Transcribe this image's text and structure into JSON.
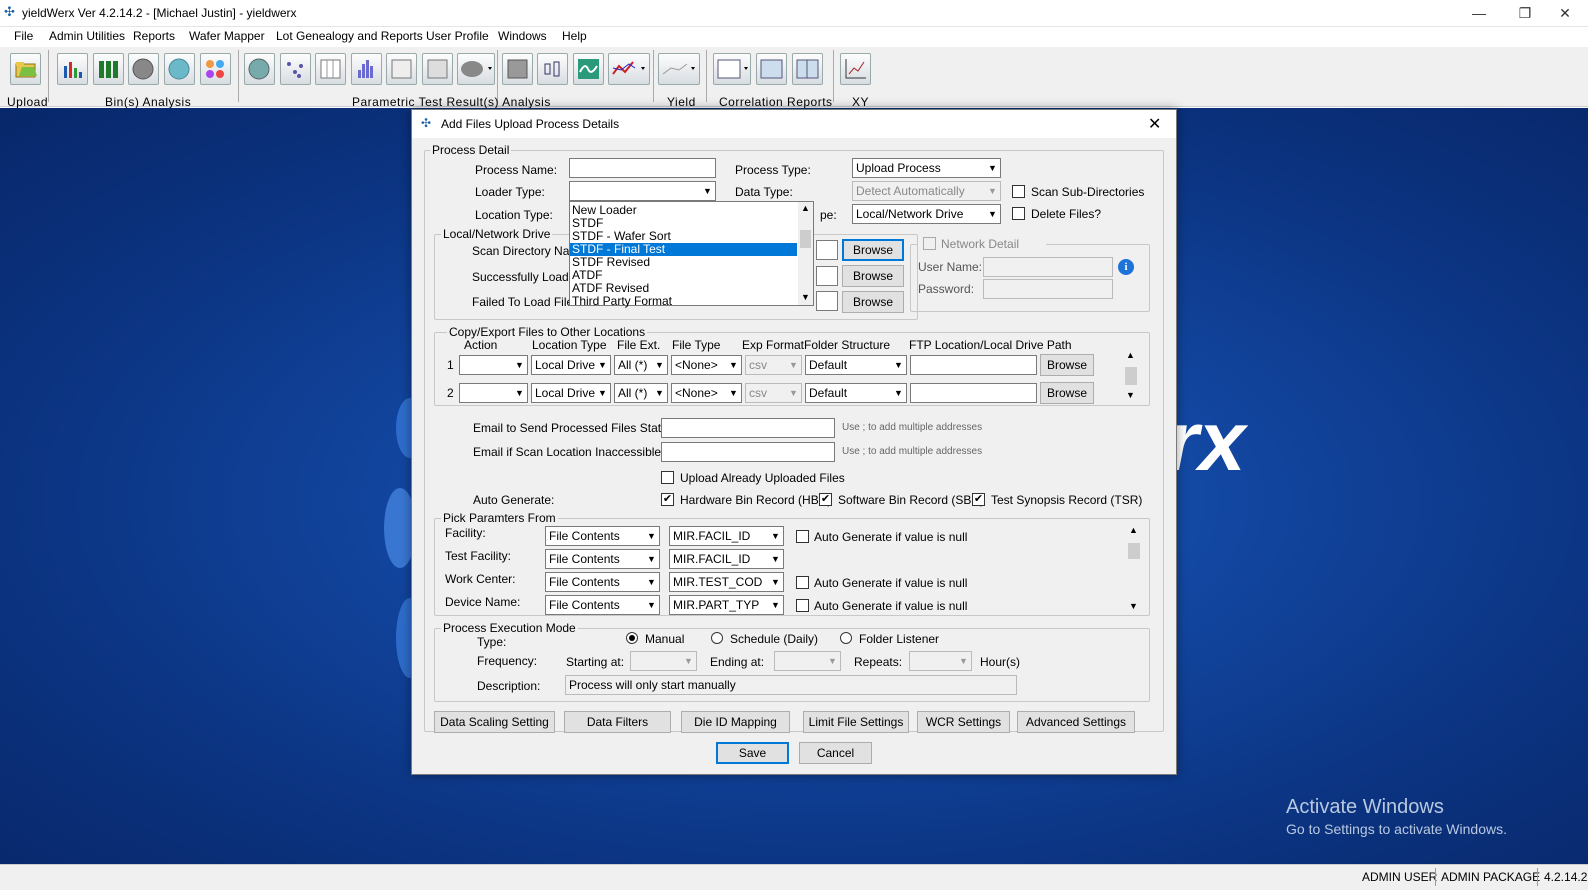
{
  "app": {
    "title": "yieldWerx Ver 4.2.14.2 - [Michael Justin] - yieldwerx",
    "window_controls": {
      "minimize": "—",
      "restore": "❐",
      "close": "✕"
    }
  },
  "menu": [
    "File",
    "Admin Utilities",
    "Reports",
    "Wafer Mapper",
    "Lot Genealogy and Reports",
    "User Profile",
    "Windows",
    "Help"
  ],
  "toolbar": {
    "groups": [
      "Upload",
      "Bin(s) Analysis",
      "Parametric Test Result(s) Analysis",
      "Yield",
      "Correlation Reports",
      "XY"
    ]
  },
  "desktop": {
    "logo_fragment": "rx",
    "watermark_title": "Activate Windows",
    "watermark_sub": "Go to Settings to activate Windows."
  },
  "statusbar": {
    "user": "ADMIN USER",
    "package": "ADMIN PACKAGE",
    "version": "4.2.14.2"
  },
  "dialog": {
    "title": "Add Files Upload Process Details",
    "process_detail": {
      "group_label": "Process Detail",
      "process_name_label": "Process Name:",
      "process_name_value": "",
      "loader_type_label": "Loader Type:",
      "loader_type_value": "",
      "location_type_label": "Location Type:",
      "process_type_label": "Process Type:",
      "process_type_value": "Upload Process",
      "data_type_label": "Data  Type:",
      "data_type_value": "Detect Automatically",
      "location_type2_label": "pe:",
      "location_type2_value": "Local/Network Drive",
      "scan_sub_label": "Scan Sub-Directories",
      "delete_files_label": "Delete Files?"
    },
    "loader_dropdown": {
      "options": [
        "New Loader",
        "STDF",
        "STDF - Wafer Sort",
        "STDF - Final Test",
        "STDF Revised",
        "ATDF",
        "ATDF Revised",
        "Third Party Format"
      ],
      "selected": "STDF - Final Test"
    },
    "local_network": {
      "group_label": "Local/Network Drive",
      "scan_dir_label": "Scan Directory Nar",
      "success_label": "Successfully Loade",
      "failed_label": "Failed To Load File",
      "browse": "Browse"
    },
    "network_detail": {
      "label": "Network Detail",
      "user_label": "User Name:",
      "password_label": "Password:",
      "info_icon": "i"
    },
    "copy_export": {
      "group_label": "Copy/Export Files to Other Locations",
      "headers": [
        "Action",
        "Location Type",
        "File Ext.",
        "File Type",
        "Exp Format",
        "Folder Structure",
        "FTP Location/Local Drive Path"
      ],
      "rows": [
        {
          "num": "1",
          "action": "",
          "location": "Local Drive",
          "ext": "All (*)",
          "type": "<None>",
          "format": "csv",
          "folder": "Default",
          "path": "",
          "browse": "Browse"
        },
        {
          "num": "2",
          "action": "",
          "location": "Local Drive",
          "ext": "All (*)",
          "type": "<None>",
          "format": "csv",
          "folder": "Default",
          "path": "",
          "browse": "Browse"
        }
      ]
    },
    "email": {
      "processed_label": "Email to Send Processed Files Status:",
      "inaccessible_label": "Email if Scan Location Inaccessible:",
      "hint": "Use ; to add multiple addresses"
    },
    "upload_already_label": "Upload Already Uploaded Files",
    "auto_generate": {
      "label": "Auto Generate:",
      "hbr": "Hardware Bin Record (HBR)",
      "sbr": "Software Bin Record (SBR)",
      "tsr": "Test Synopsis Record (TSR)"
    },
    "pick_params": {
      "group_label": "Pick Paramters From",
      "rows": [
        {
          "label": "Facility:",
          "source": "File Contents",
          "field": "MIR.FACIL_ID",
          "auto": "Auto Generate if value is null",
          "has_auto": true
        },
        {
          "label": "Test Facility:",
          "source": "File Contents",
          "field": "MIR.FACIL_ID",
          "auto": "",
          "has_auto": false
        },
        {
          "label": "Work Center:",
          "source": "File Contents",
          "field": "MIR.TEST_COD",
          "auto": "Auto Generate if value is null",
          "has_auto": true
        },
        {
          "label": "Device Name:",
          "source": "File Contents",
          "field": "MIR.PART_TYP",
          "auto": "Auto Generate if value is null",
          "has_auto": true
        }
      ]
    },
    "execution": {
      "group_label": "Process Execution Mode",
      "type_label": "Type:",
      "manual": "Manual",
      "schedule": "Schedule (Daily)",
      "folder_listener": "Folder Listener",
      "frequency_label": "Frequency:",
      "starting_label": "Starting at:",
      "ending_label": "Ending at:",
      "repeats_label": "Repeats:",
      "hours_label": "Hour(s)",
      "description_label": "Description:",
      "description_value": "Process will only start manually"
    },
    "buttons": {
      "data_scaling": "Data Scaling Setting",
      "data_filters": "Data Filters",
      "die_id": "Die ID Mapping",
      "limit_file": "Limit File Settings",
      "wcr": "WCR Settings",
      "advanced": "Advanced Settings",
      "save": "Save",
      "cancel": "Cancel"
    }
  }
}
